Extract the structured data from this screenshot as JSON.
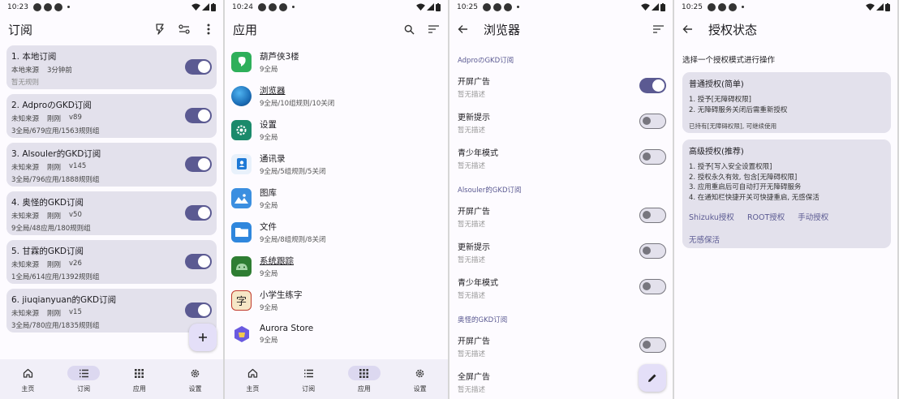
{
  "colors": {
    "accent": "#5b5a92",
    "card": "#e3e1ec",
    "background": "#fdfbff",
    "nav": "#f1eff8"
  },
  "panel1": {
    "time": "10:23",
    "title": "订阅",
    "actions": [
      "flash-icon",
      "sliders-icon",
      "more-vert-icon"
    ],
    "subscriptions": [
      {
        "name": "1. 本地订阅",
        "source": "本地来源",
        "updated": "3分钟前",
        "version": "",
        "stats": "暂无规则",
        "enabled": true
      },
      {
        "name": "2. AdproのGKD订阅",
        "source": "未知来源",
        "updated": "刚刚",
        "version": "v89",
        "stats": "3全局/679应用/1563规则组",
        "enabled": true
      },
      {
        "name": "3. Alsouler的GKD订阅",
        "source": "未知来源",
        "updated": "刚刚",
        "version": "v145",
        "stats": "3全局/796应用/1888规则组",
        "enabled": true
      },
      {
        "name": "4. 奥怪的GKD订阅",
        "source": "未知来源",
        "updated": "刚刚",
        "version": "v50",
        "stats": "9全局/48应用/180规则组",
        "enabled": true
      },
      {
        "name": "5. 甘霖的GKD订阅",
        "source": "未知来源",
        "updated": "刚刚",
        "version": "v26",
        "stats": "1全局/614应用/1392规则组",
        "enabled": true
      },
      {
        "name": "6. jiuqianyuan的GKD订阅",
        "source": "未知来源",
        "updated": "刚刚",
        "version": "v15",
        "stats": "3全局/780应用/1835规则组",
        "enabled": true
      }
    ],
    "fab_icon": "plus-icon",
    "nav": [
      {
        "label": "主页",
        "icon": "home-icon",
        "active": false
      },
      {
        "label": "订阅",
        "icon": "list-icon",
        "active": true
      },
      {
        "label": "应用",
        "icon": "apps-icon",
        "active": false
      },
      {
        "label": "设置",
        "icon": "gear-icon",
        "active": false
      }
    ]
  },
  "panel2": {
    "time": "10:24",
    "title": "应用",
    "actions": [
      "search-icon",
      "sort-icon"
    ],
    "apps": [
      {
        "name": "葫芦侠3楼",
        "desc": "9全局",
        "icon": "huluxia-icon",
        "color": "#2eaf5a"
      },
      {
        "name": "浏览器",
        "desc": "9全局/10组规则/10关闭",
        "icon": "browser-icon",
        "color": "#1c6fb8"
      },
      {
        "name": "设置",
        "desc": "9全局",
        "icon": "settings-app-icon",
        "color": "#1b8a6b"
      },
      {
        "name": "通讯录",
        "desc": "9全局/5组规则/5关闭",
        "icon": "contacts-icon",
        "color": "#1f7ad6"
      },
      {
        "name": "图库",
        "desc": "9全局",
        "icon": "gallery-icon",
        "color": "#3b8fe0"
      },
      {
        "name": "文件",
        "desc": "9全局/8组规则/8关闭",
        "icon": "files-icon",
        "color": "#2f87dd"
      },
      {
        "name": "系统跟踪",
        "desc": "9全局",
        "icon": "android-icon",
        "color": "#2e7d32"
      },
      {
        "name": "小学生练字",
        "desc": "9全局",
        "icon": "calligraphy-icon",
        "color": "#c0392b"
      },
      {
        "name": "Aurora Store",
        "desc": "9全局",
        "icon": "aurora-icon",
        "color": "#6a5ae0"
      }
    ],
    "nav": [
      {
        "label": "主页",
        "icon": "home-icon",
        "active": false
      },
      {
        "label": "订阅",
        "icon": "list-icon",
        "active": false
      },
      {
        "label": "应用",
        "icon": "apps-icon",
        "active": true
      },
      {
        "label": "设置",
        "icon": "gear-icon",
        "active": false
      }
    ]
  },
  "panel3": {
    "time": "10:25",
    "title": "浏览器",
    "groups": [
      {
        "title": "AdproのGKD订阅",
        "rules": [
          {
            "name": "开屏广告",
            "desc": "暂无描述",
            "enabled": true
          },
          {
            "name": "更新提示",
            "desc": "暂无描述",
            "enabled": false
          },
          {
            "name": "青少年模式",
            "desc": "暂无描述",
            "enabled": false
          }
        ]
      },
      {
        "title": "Alsouler的GKD订阅",
        "rules": [
          {
            "name": "开屏广告",
            "desc": "暂无描述",
            "enabled": false
          },
          {
            "name": "更新提示",
            "desc": "暂无描述",
            "enabled": false
          },
          {
            "name": "青少年模式",
            "desc": "暂无描述",
            "enabled": false
          }
        ]
      },
      {
        "title": "奥怪的GKD订阅",
        "rules": [
          {
            "name": "开屏广告",
            "desc": "暂无描述",
            "enabled": false
          },
          {
            "name": "全屏广告",
            "desc": "暂无描述",
            "enabled": null
          }
        ]
      }
    ],
    "fab_icon": "edit-icon"
  },
  "panel4": {
    "time": "10:25",
    "title": "授权状态",
    "prompt": "选择一个授权模式进行操作",
    "normal": {
      "title": "普通授权(简单)",
      "items": [
        "1. 授予[无障碍权限]",
        "2. 无障碍服务关闭后需重新授权"
      ],
      "note": "已持有[无障碍权限], 可继续使用"
    },
    "advanced": {
      "title": "高级授权(推荐)",
      "items": [
        "1. 授予[写入安全设置权限]",
        "2. 授权永久有效, 包含[无障碍权限]",
        "3. 应用重启后可自动打开无障碍服务",
        "4. 在通知栏快捷开关可快捷重启, 无感保活"
      ],
      "buttons": [
        "Shizuku授权",
        "ROOT授权",
        "手动授权"
      ],
      "extra_button": "无感保活"
    }
  }
}
